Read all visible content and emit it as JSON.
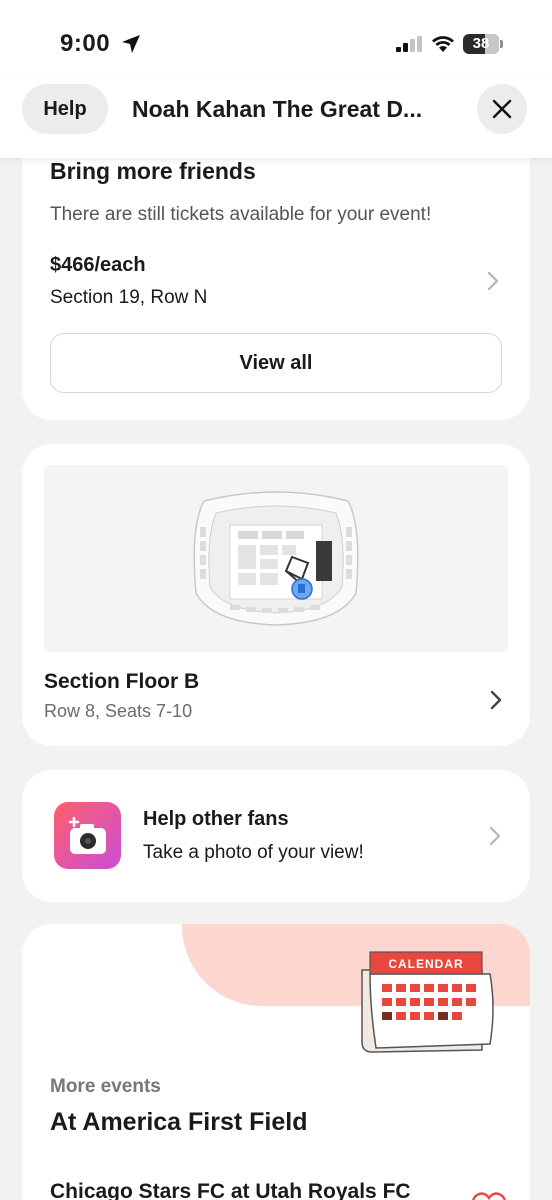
{
  "status_bar": {
    "time": "9:00",
    "battery": "38"
  },
  "header": {
    "help_label": "Help",
    "title": "Noah Kahan The Great D..."
  },
  "more_friends": {
    "title": "Bring more friends",
    "subtitle": "There are still tickets available for your event!",
    "price": "$466/each",
    "section": "Section 19, Row N",
    "view_all_label": "View all"
  },
  "seat": {
    "section": "Section Floor B",
    "row_seats": "Row 8, Seats 7-10"
  },
  "help_fans": {
    "title": "Help other fans",
    "subtitle": "Take a photo of your view!"
  },
  "more_events": {
    "label": "More events",
    "venue": "At America First Field",
    "calendar_label": "CALENDAR",
    "event_name": "Chicago Stars FC at Utah Royals FC"
  },
  "colors": {
    "accent_pink": "#fcd6cf",
    "calendar_red": "#e8473f",
    "seat_blue": "#2b6fd6"
  }
}
